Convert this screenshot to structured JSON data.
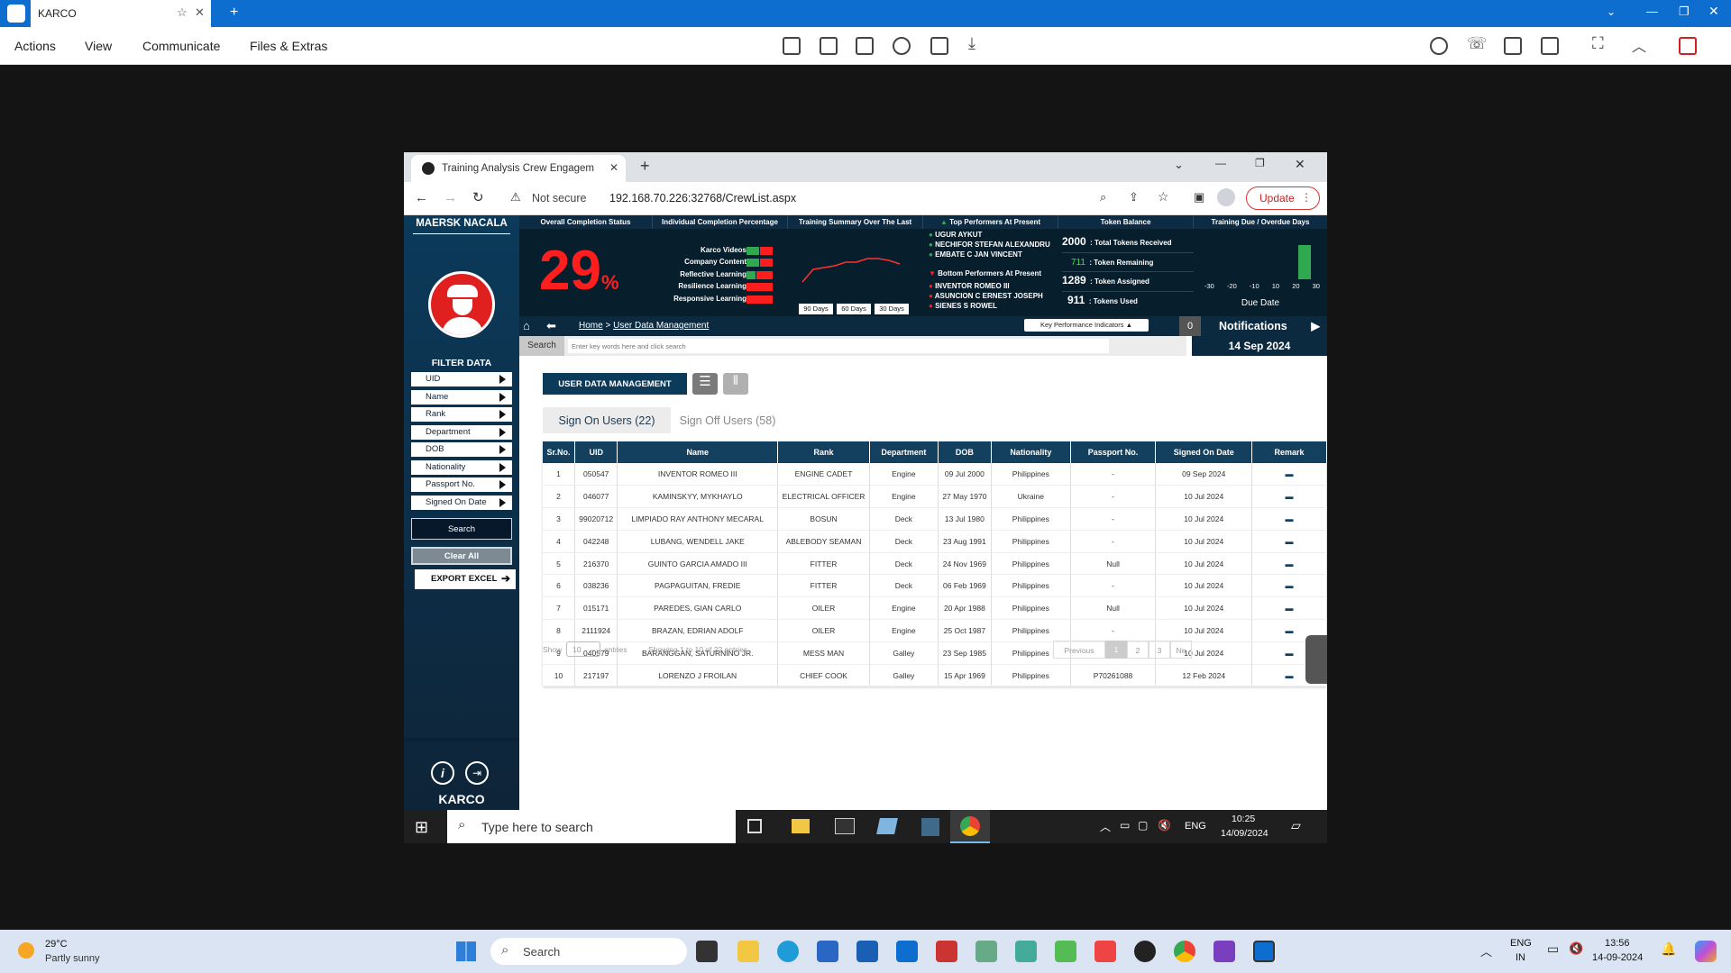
{
  "teamviewer": {
    "tab_title": "KARCO",
    "menus": [
      "Actions",
      "View",
      "Communicate",
      "Files & Extras"
    ]
  },
  "chrome": {
    "tab_title": "Training Analysis Crew Engagem",
    "not_secure": "Not secure",
    "url": "192.168.70.226:32768/CrewList.aspx",
    "update_label": "Update"
  },
  "sidebar": {
    "vessel_name": "MAERSK NACALA",
    "filter_title": "FILTER DATA",
    "filters": [
      "UID",
      "Name",
      "Rank",
      "Department",
      "DOB",
      "Nationality",
      "Passport No.",
      "Signed On Date"
    ],
    "search_label": "Search",
    "clear_label": "Clear All",
    "export_label": "EXPORT EXCEL",
    "brand": "KARCO"
  },
  "kpi": {
    "overall_title": "Overall Completion Status",
    "overall_value": "29",
    "overall_unit": "%",
    "individual_title": "Individual Completion Percentage",
    "individual_items": [
      "Karco Videos",
      "Company Content",
      "Reflective Learning",
      "Resilience Learning",
      "Responsive Learning"
    ],
    "summary_title": "Training Summary Over The Last",
    "summary_buttons": [
      "90 Days",
      "60 Days",
      "30 Days"
    ],
    "top_title": "Top Performers At Present",
    "top_names": [
      "UGUR AYKUT",
      "NECHIFOR STEFAN ALEXANDRU",
      "EMBATE C JAN VINCENT"
    ],
    "bottom_title": "Bottom Performers At Present",
    "bottom_names": [
      "INVENTOR ROMEO III",
      "ASUNCION C ERNEST JOSEPH",
      "SIENES S ROWEL"
    ],
    "token_title": "Token Balance",
    "tokens": [
      {
        "value": "2000",
        "label": ": Total Tokens Received"
      },
      {
        "value": "711",
        "label": ": Token Remaining"
      },
      {
        "value": "1289",
        "label": ": Token Assigned"
      },
      {
        "value": "911",
        "label": ": Tokens Used"
      }
    ],
    "due_title": "Training Due / Overdue Days",
    "due_ticks": [
      "-30",
      "-20",
      "-10",
      "10",
      "20",
      "30"
    ],
    "due_label": "Due Date"
  },
  "crumb": {
    "home": "Home",
    "sep": ">",
    "current": "User Data Management",
    "kpi_toggle": "Key Performance Indicators",
    "notif_count": "0",
    "notif_label": "Notifications",
    "date": "14 Sep 2024"
  },
  "search": {
    "label": "Search",
    "placeholder": "Enter key words here and click search"
  },
  "main": {
    "section_button": "USER DATA MANAGEMENT",
    "tab_on": "Sign On Users (22)",
    "tab_off": "Sign Off Users (58)",
    "columns": [
      "Sr.No.",
      "UID",
      "Name",
      "Rank",
      "Department",
      "DOB",
      "Nationality",
      "Passport No.",
      "Signed On Date",
      "Remark"
    ],
    "rows": [
      [
        "1",
        "050547",
        "INVENTOR ROMEO III",
        "ENGINE CADET",
        "Engine",
        "09 Jul 2000",
        "Philippines",
        "-",
        "09 Sep 2024"
      ],
      [
        "2",
        "046077",
        "KAMINSKYY, MYKHAYLO",
        "ELECTRICAL OFFICER",
        "Engine",
        "27 May 1970",
        "Ukraine",
        "-",
        "10 Jul 2024"
      ],
      [
        "3",
        "99020712",
        "LIMPIADO RAY ANTHONY MECARAL",
        "BOSUN",
        "Deck",
        "13 Jul 1980",
        "Philippines",
        "-",
        "10 Jul 2024"
      ],
      [
        "4",
        "042248",
        "LUBANG, WENDELL JAKE",
        "ABLEBODY SEAMAN",
        "Deck",
        "23 Aug 1991",
        "Philippines",
        "-",
        "10 Jul 2024"
      ],
      [
        "5",
        "216370",
        "GUINTO GARCIA AMADO III",
        "FITTER",
        "Deck",
        "24 Nov 1969",
        "Philippines",
        "Null",
        "10 Jul 2024"
      ],
      [
        "6",
        "038236",
        "PAGPAGUITAN, FREDIE",
        "FITTER",
        "Deck",
        "06 Feb 1969",
        "Philippines",
        "-",
        "10 Jul 2024"
      ],
      [
        "7",
        "015171",
        "PAREDES, GIAN CARLO",
        "OILER",
        "Engine",
        "20 Apr 1988",
        "Philippines",
        "Null",
        "10 Jul 2024"
      ],
      [
        "8",
        "2111924",
        "BRAZAN, EDRIAN ADOLF",
        "OILER",
        "Engine",
        "25 Oct 1987",
        "Philippines",
        "-",
        "10 Jul 2024"
      ],
      [
        "9",
        "040579",
        "BARANGGAN, SATURNINO JR.",
        "MESS MAN",
        "Galley",
        "23 Sep 1985",
        "Philippines",
        "-",
        "10 Jul 2024"
      ],
      [
        "10",
        "217197",
        "LORENZO J FROILAN",
        "CHIEF COOK",
        "Galley",
        "15 Apr 1969",
        "Philippines",
        "P70261088",
        "12 Feb 2024"
      ]
    ],
    "show_label": "Show",
    "show_value": "10",
    "entries_label": "entries",
    "showing_text": "Showing 1 to 10 of 22 entries",
    "prev_label": "Previous",
    "pages": [
      "1",
      "2",
      "3"
    ],
    "next_label": "Ne"
  },
  "remote_taskbar": {
    "search_placeholder": "Type here to search",
    "lang": "ENG",
    "time": "10:25",
    "date": "14/09/2024"
  },
  "host_taskbar": {
    "weather_temp": "29°C",
    "weather_desc": "Partly sunny",
    "search_label": "Search",
    "lang_line1": "ENG",
    "lang_line2": "IN",
    "time": "13:56",
    "date": "14-09-2024"
  },
  "colors": {
    "teamviewer_blue": "#0e6ecf",
    "accent_red": "#e0201f",
    "navy": "#14405f",
    "bar_green": "#2fa84f"
  }
}
